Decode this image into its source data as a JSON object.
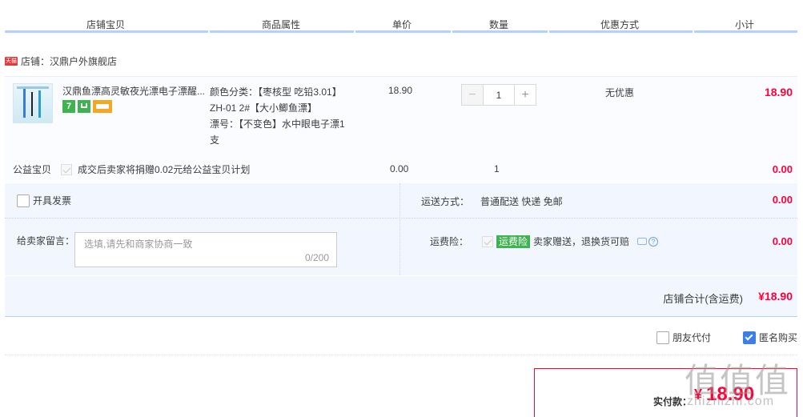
{
  "columns": {
    "shop_item": "店铺宝贝",
    "attributes": "商品属性",
    "unit_price": "单价",
    "quantity": "数量",
    "discount": "优惠方式",
    "subtotal": "小计"
  },
  "shop": {
    "badge": "天猫",
    "label": "店铺：汉鼎户外旗舰店"
  },
  "item": {
    "title": "汉鼎鱼漂高灵敏夜光漂电子漂醒...",
    "props": {
      "line1": "颜色分类：【枣核型 吃铅3.01】",
      "line2": "ZH-01 2#【大小鲫鱼漂】",
      "line3": "漂号：【不变色】水中眼电子漂1",
      "line4": "支"
    },
    "price": "18.90",
    "quantity": "1",
    "promo": "无优惠",
    "subtotal": "18.90",
    "service_icons": [
      "7-day-return-icon",
      "guarantee-icon",
      "credit-card-icon"
    ]
  },
  "charity": {
    "label": "公益宝贝",
    "text": "成交后卖家将捐赠0.02元给公益宝贝计划",
    "price": "0.00",
    "quantity": "1",
    "subtotal": "0.00"
  },
  "invoice": {
    "label": "开具发票"
  },
  "shipping": {
    "label": "运送方式：",
    "value": "普通配送 快递 免邮",
    "amount": "0.00"
  },
  "message": {
    "label": "给卖家留言：",
    "placeholder": "选填,请先和商家协商一致",
    "counter": "0/200"
  },
  "insurance": {
    "label": "运费险：",
    "tag": "运费险",
    "text": "卖家赠送，退换货可赔",
    "amount": "0.00"
  },
  "shop_total": {
    "label": "店铺合计(含运费)",
    "amount": "¥18.90"
  },
  "options": {
    "friend_pay": "朋友代付",
    "anonymous": "匿名购买"
  },
  "pay": {
    "label": "实付款：",
    "currency": "¥",
    "amount": "18.90"
  },
  "watermark": {
    "main": "值值值",
    "sub": "zhizhizhi.com"
  },
  "colors": {
    "accent_red": "#ff0036",
    "header_line": "#b2d1ff",
    "panel_bg": "#f2f7ff",
    "checkbox_blue": "#3d7fe6",
    "insurance_green": "#3fb34f"
  }
}
